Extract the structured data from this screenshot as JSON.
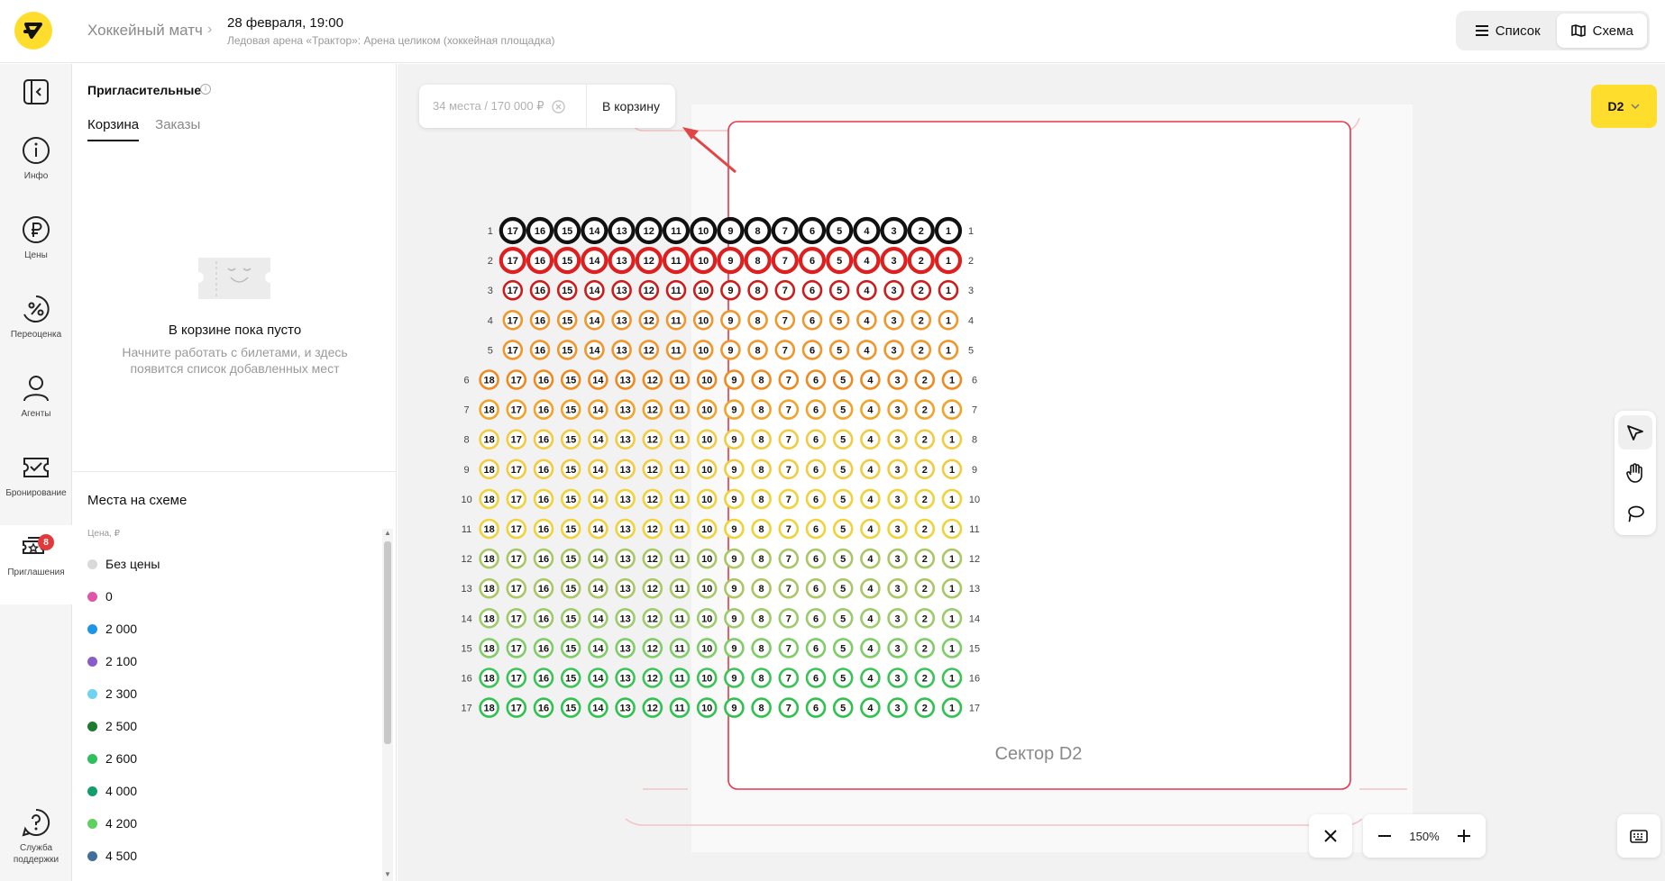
{
  "header": {
    "event_title": "Хоккейный матч",
    "event_date": "28 февраля, 19:00",
    "event_venue": "Ледовая арена «Трактор»: Арена целиком (хоккейная площадка)",
    "view_list_label": "Список",
    "view_map_label": "Схема"
  },
  "rail": {
    "items": [
      {
        "label": "Инфо",
        "icon": "info-icon"
      },
      {
        "label": "Цены",
        "icon": "ruble-icon"
      },
      {
        "label": "Переоценка",
        "icon": "percent-icon"
      },
      {
        "label": "Агенты",
        "icon": "person-icon"
      },
      {
        "label": "Бронирование",
        "icon": "booking-icon"
      },
      {
        "label": "Приглашения",
        "icon": "tickets-icon",
        "badge": "8"
      }
    ],
    "support_label": "Служба поддержки"
  },
  "panel": {
    "title": "Пригласительные",
    "tabs": [
      "Корзина",
      "Заказы"
    ],
    "empty_title": "В корзине пока пусто",
    "empty_desc": "Начните работать с билетами, и здесь появится список добавленных мест",
    "seats_title": "Места на схеме",
    "price_header": "Цена, ₽",
    "legend": [
      {
        "label": "Без цены",
        "color": "#d9d9d9"
      },
      {
        "label": "0",
        "color": "#e055a8"
      },
      {
        "label": "2 000",
        "color": "#1e95e6"
      },
      {
        "label": "2 100",
        "color": "#8a5cc7"
      },
      {
        "label": "2 300",
        "color": "#6fd2f2"
      },
      {
        "label": "2 500",
        "color": "#1d7a2e"
      },
      {
        "label": "2 600",
        "color": "#2fbf5c"
      },
      {
        "label": "4 000",
        "color": "#129e6a"
      },
      {
        "label": "4 200",
        "color": "#5fd15f"
      },
      {
        "label": "4 500",
        "color": "#3f6f9a"
      }
    ]
  },
  "canvas": {
    "cart_summary": "34 места / 170 000 ₽",
    "cart_button": "В корзину",
    "sector_select": "D2",
    "sector_label": "Сектор D2",
    "zoom": "150%",
    "rows": [
      {
        "row": 1,
        "count": 17,
        "color": "#111111",
        "large": true
      },
      {
        "row": 2,
        "count": 17,
        "color": "#dd1f1f",
        "large": true
      },
      {
        "row": 3,
        "count": 17,
        "color": "#cc1c1c"
      },
      {
        "row": 4,
        "count": 17,
        "color": "#f0962a"
      },
      {
        "row": 5,
        "count": 17,
        "color": "#f0962a"
      },
      {
        "row": 6,
        "count": 18,
        "color": "#f08a1f"
      },
      {
        "row": 7,
        "count": 18,
        "color": "#f2a32a"
      },
      {
        "row": 8,
        "count": 18,
        "color": "#f2cc40"
      },
      {
        "row": 9,
        "count": 18,
        "color": "#f2cc40"
      },
      {
        "row": 10,
        "count": 18,
        "color": "#f0d23a"
      },
      {
        "row": 11,
        "count": 18,
        "color": "#f0d23a"
      },
      {
        "row": 12,
        "count": 18,
        "color": "#a9c765"
      },
      {
        "row": 13,
        "count": 18,
        "color": "#a9c765"
      },
      {
        "row": 14,
        "count": 18,
        "color": "#9ccb6a"
      },
      {
        "row": 15,
        "count": 18,
        "color": "#7fcd67"
      },
      {
        "row": 16,
        "count": 18,
        "color": "#3bc456"
      },
      {
        "row": 17,
        "count": 18,
        "color": "#2fc24f"
      }
    ]
  }
}
